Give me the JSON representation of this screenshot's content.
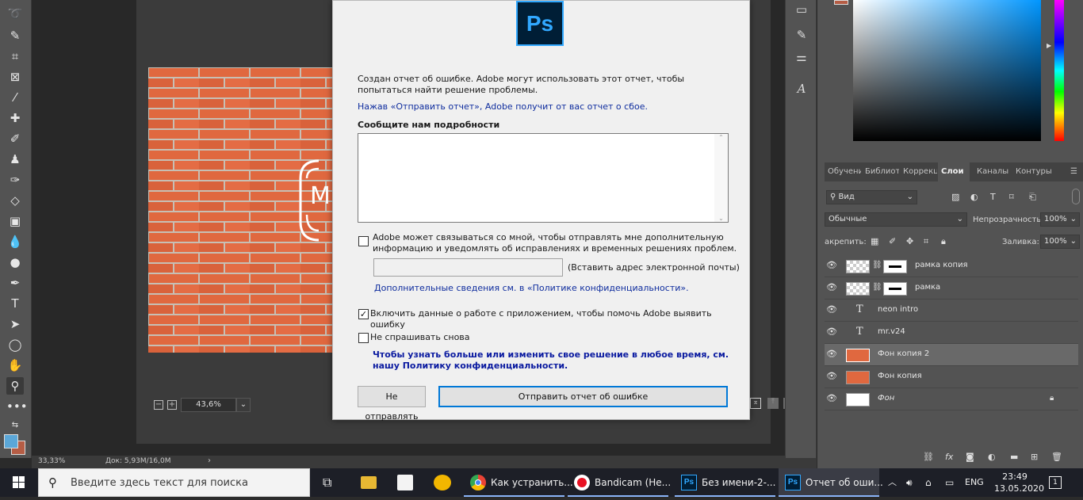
{
  "dialog": {
    "intro": "Создан отчет об ошибке. Adobe могут использовать этот отчет, чтобы попытаться найти решение проблемы.",
    "send_hint": "Нажав «Отправить отчет», Adobe получит от вас отчет о сбое.",
    "details_label": "Сообщите нам подробности",
    "details_value": "",
    "contact_text": "Adobe может связываться со мной, чтобы отправлять мне дополнительную информацию и уведомлять об исправлениях и временных решениях проблем.",
    "contact_checked": false,
    "email_placeholder": "",
    "email_hint": "(Вставить адрес электронной почты)",
    "privacy_link": "Дополнительные сведения см. в «Политике конфиденциальности».",
    "include_data_text": "Включить данные о работе с приложением, чтобы помочь Adobe выявить ошибку",
    "include_data_checked": true,
    "dont_ask_text": "Не спрашивать снова",
    "dont_ask_checked": false,
    "policy_note": "Чтобы узнать больше или изменить свое решение в любое время, см. нашу Политику конфиденциальности.",
    "dont_send_button": "Не отправлять",
    "send_button": "Отправить отчет об ошибке",
    "logo_text": "Ps"
  },
  "canvas": {
    "zoom": "43,6%",
    "logo_letter": "M"
  },
  "statusbar": {
    "zoom": "33,33%",
    "doc": "Док: 5,93M/16,0M"
  },
  "panel_tabs": [
    "Обучени",
    "Библиот",
    "Коррекц",
    "Слои",
    "Каналы",
    "Контуры"
  ],
  "layers_panel": {
    "filter": "Вид",
    "blend_mode": "Обычные",
    "opacity_label": "Непрозрачность:",
    "opacity_value": "100%",
    "lock_label": "акрепить:",
    "fill_label": "Заливка:",
    "fill_value": "100%",
    "layers": [
      {
        "name": "рамка копия",
        "kind": "mask"
      },
      {
        "name": "рамка",
        "kind": "mask"
      },
      {
        "name": "neon intro",
        "kind": "text"
      },
      {
        "name": "mr.v24",
        "kind": "text"
      },
      {
        "name": "Фон копия 2",
        "kind": "brick",
        "selected": true
      },
      {
        "name": "Фон копия",
        "kind": "brick"
      },
      {
        "name": "Фон",
        "kind": "white",
        "locked": true
      }
    ]
  },
  "colors": {
    "foreground": "#5ba7d8",
    "background": "#b55d45",
    "accent": "#0078d7",
    "ps_blue": "#31a8ff"
  },
  "taskbar": {
    "search_placeholder": "Введите здесь текст для поиска",
    "apps": [
      {
        "label": "Как устранить...",
        "icon": "chrome-icon"
      },
      {
        "label": "Bandicam (Не...",
        "icon": "record-icon"
      },
      {
        "label": "Без имени-2-...",
        "icon": "photoshop-icon"
      },
      {
        "label": "Отчет об оши...",
        "icon": "photoshop-icon"
      }
    ],
    "lang": "ENG",
    "time": "23:49",
    "date": "13.05.2020",
    "notifications": "1"
  }
}
